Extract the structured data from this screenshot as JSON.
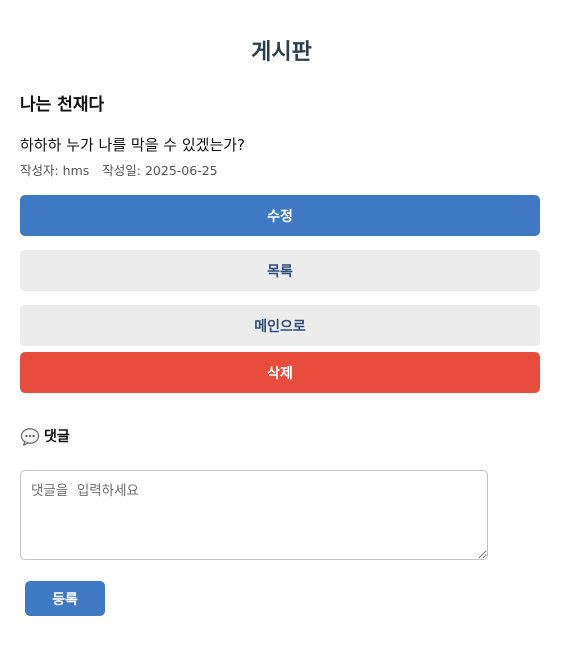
{
  "header": {
    "title": "게시판"
  },
  "post": {
    "title": "나는 천재다",
    "content": "하하하 누가 나를 막을 수 있겠는가?",
    "author_label": "작성자: hms",
    "date_label": "작성일: 2025-06-25"
  },
  "actions": {
    "edit_label": "수정",
    "list_label": "목록",
    "main_label": "메인으로",
    "delete_label": "삭제"
  },
  "comments": {
    "heading": "댓글",
    "heading_icon": "speech-bubble-icon",
    "input_placeholder": "댓글을  입력하세요",
    "input_value": "",
    "submit_label": "등록"
  },
  "colors": {
    "primary": "#3f78c3",
    "secondary_bg": "#ececec",
    "secondary_text": "#2f4e7a",
    "danger": "#e74c3c",
    "title": "#2c3e50"
  }
}
